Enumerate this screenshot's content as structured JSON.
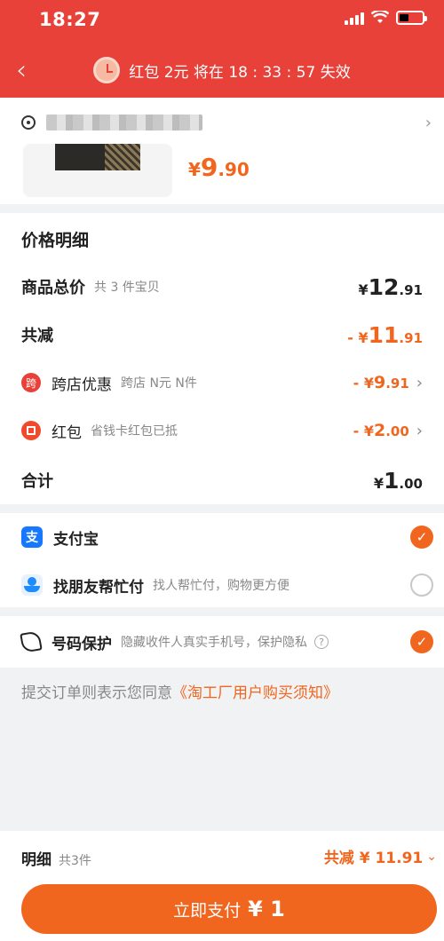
{
  "status": {
    "time": "18:27"
  },
  "nav": {
    "back_icon": "‹",
    "text": "红包 2元 将在 18 : 33 : 57 失效"
  },
  "address": {
    "arrow": "›"
  },
  "product": {
    "price_symbol": "¥",
    "price_int": "9",
    "price_dec": ".90"
  },
  "price_detail": {
    "title": "价格明细",
    "goods_total": {
      "label": "商品总价",
      "sub": "共 3 件宝贝",
      "cur": "¥",
      "int": "12",
      "dec": ".91"
    },
    "discount": {
      "label": "共减",
      "cur": "- ¥",
      "int": "11",
      "dec": ".91"
    },
    "cross_store": {
      "badge": "跨",
      "label": "跨店优惠",
      "sub": "跨店 N元 N件",
      "cur": "- ¥",
      "int": "9",
      "dec": ".91",
      "chev": "›"
    },
    "red_packet": {
      "label": "红包",
      "sub": "省钱卡红包已抵",
      "cur": "- ¥",
      "int": "2",
      "dec": ".00",
      "chev": "›"
    },
    "total": {
      "label": "合计",
      "cur": "¥",
      "int": "1",
      "dec": ".00"
    }
  },
  "payment": {
    "alipay": {
      "icon": "支",
      "name": "支付宝",
      "check": "✓",
      "selected": true
    },
    "friend": {
      "name": "找朋友帮忙付",
      "sub": "找人帮忙付，购物更方便",
      "selected": false
    }
  },
  "phone_protect": {
    "name": "号码保护",
    "sub": "隐藏收件人真实手机号，保护隐私",
    "help": "?",
    "check": "✓",
    "selected": true
  },
  "agreement": {
    "prefix": "提交订单则表示您同意",
    "link": "《淘工厂用户购买须知》"
  },
  "bottom": {
    "detail_label": "明细",
    "count": "共3件",
    "saving": "共减 ¥ 11.91",
    "chev": "⌄",
    "pay_label": "立即支付",
    "pay_amount": "¥ 1"
  },
  "colors": {
    "brand_red": "#e8413a",
    "accent_orange": "#f1661e",
    "alipay_blue": "#1677ff"
  }
}
